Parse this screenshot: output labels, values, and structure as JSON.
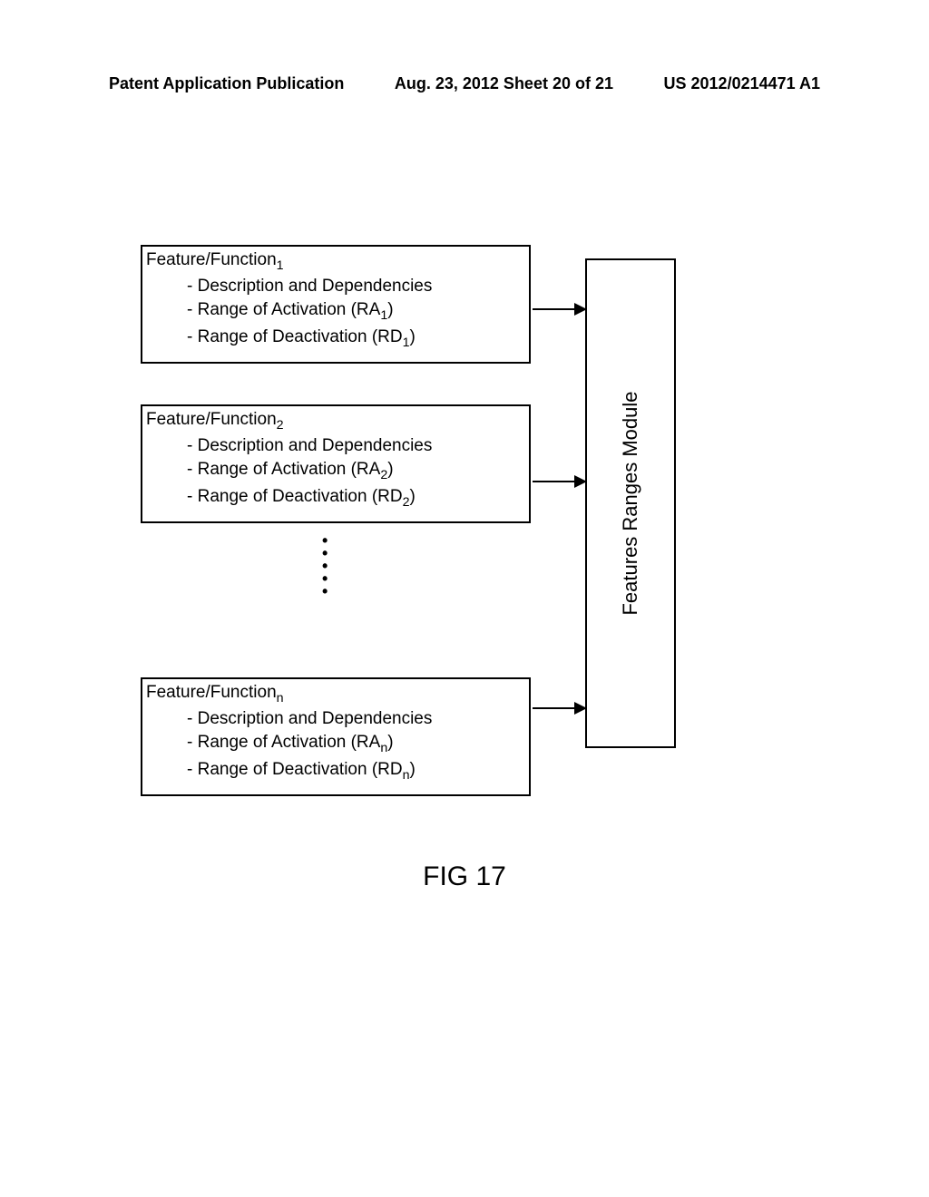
{
  "header": {
    "left": "Patent Application Publication",
    "center": "Aug. 23, 2012  Sheet 20 of 21",
    "right": "US 2012/0214471 A1"
  },
  "box1": {
    "title_pre": "Feature/Function",
    "title_sub": "1",
    "item1": "- Description and Dependencies",
    "item2_pre": "- Range of Activation (RA",
    "item2_sub": "1",
    "item2_post": ")",
    "item3_pre": "- Range of Deactivation (RD",
    "item3_sub": "1",
    "item3_post": ")"
  },
  "box2": {
    "title_pre": "Feature/Function",
    "title_sub": "2",
    "item1": "- Description and Dependencies",
    "item2_pre": "- Range of Activation (RA",
    "item2_sub": "2",
    "item2_post": ")",
    "item3_pre": "- Range of Deactivation (RD",
    "item3_sub": "2",
    "item3_post": ")"
  },
  "boxn": {
    "title_pre": "Feature/Function",
    "title_sub": "n",
    "item1": "- Description and Dependencies",
    "item2_pre": "- Range of Activation (RA",
    "item2_sub": "n",
    "item2_post": ")",
    "item3_pre": "- Range of Deactivation (RD",
    "item3_sub": "n",
    "item3_post": ")"
  },
  "module_label": "Features Ranges Module",
  "figure_label": "FIG 17"
}
